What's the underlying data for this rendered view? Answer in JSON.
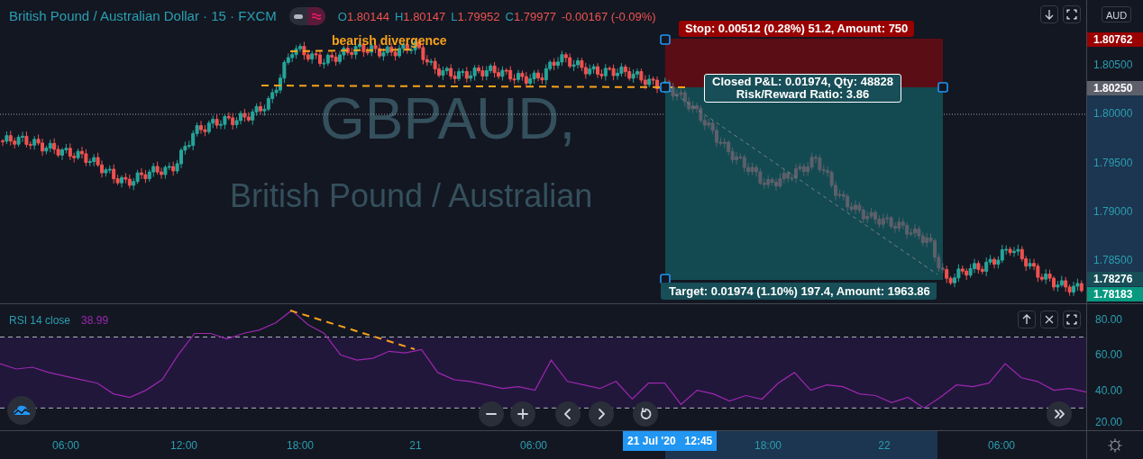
{
  "header": {
    "title": "British Pound / Australian Dollar · 15 · FXCM",
    "ohlc": [
      {
        "label": "O",
        "value": "1.80144"
      },
      {
        "label": "H",
        "value": "1.80147"
      },
      {
        "label": "L",
        "value": "1.79952"
      },
      {
        "label": "C",
        "value": "1.79977"
      }
    ],
    "change": "-0.00167 (-0.09%)"
  },
  "currency_badge": "AUD",
  "watermark": {
    "symbol": "GBPAUD,",
    "description": "British Pound / Australian"
  },
  "annotation": "bearish divergence",
  "position": {
    "stop_label": "Stop: 0.00512 (0.28%) 51.2, Amount: 750",
    "pnl_lines": [
      "Closed P&L: 0.01974, Qty: 48828",
      "Risk/Reward Ratio: 3.86"
    ],
    "target_label": "Target: 0.01974 (1.10%) 197.4, Amount: 1963.86"
  },
  "price_axis": {
    "ticks": [
      "1.80500",
      "1.80000",
      "1.79500",
      "1.79000",
      "1.78500"
    ],
    "labels": [
      {
        "text": "1.80762",
        "kind": "stop"
      },
      {
        "text": "1.80250",
        "kind": "entry"
      },
      {
        "text": "1.78276",
        "kind": "target"
      },
      {
        "text": "1.78183",
        "kind": "last"
      }
    ]
  },
  "rsi": {
    "value": "38.99",
    "chart_data": {
      "type": "line",
      "ylim": [
        17.5,
        88.5
      ],
      "ref_lines": [
        {
          "axis": "y",
          "value": 70
        },
        {
          "axis": "y",
          "value": 30
        }
      ],
      "yticks": [
        {
          "value": 80,
          "label": "80.00"
        },
        {
          "value": 60,
          "label": "60.00"
        },
        {
          "value": 40,
          "label": "40.00"
        },
        {
          "value": 20,
          "label": "20.00"
        }
      ],
      "series": [
        {
          "name": "RSI 14 close",
          "color": "#9c27b0",
          "values": [
            55,
            52,
            53,
            50,
            48,
            46,
            44,
            38,
            36,
            40,
            46,
            60,
            72,
            72,
            69,
            72,
            74,
            78,
            85,
            77,
            72,
            60,
            57,
            58,
            62,
            61,
            63,
            50,
            46,
            45,
            43,
            41,
            42,
            40,
            57,
            45,
            43,
            41,
            45,
            35,
            44,
            44,
            32,
            40,
            38,
            34,
            37,
            35,
            44,
            50,
            40,
            43,
            42,
            38,
            37,
            33,
            36,
            30,
            36,
            43,
            42,
            44,
            55,
            47,
            45,
            40,
            41,
            39
          ]
        }
      ]
    }
  },
  "time_axis": {
    "ticks": [
      "06:00",
      "12:00",
      "18:00",
      "21",
      "06:00",
      "18:00",
      "22",
      "06:00"
    ],
    "crosshair_label": {
      "date": "21 Jul '20",
      "time": "12:45"
    }
  }
}
